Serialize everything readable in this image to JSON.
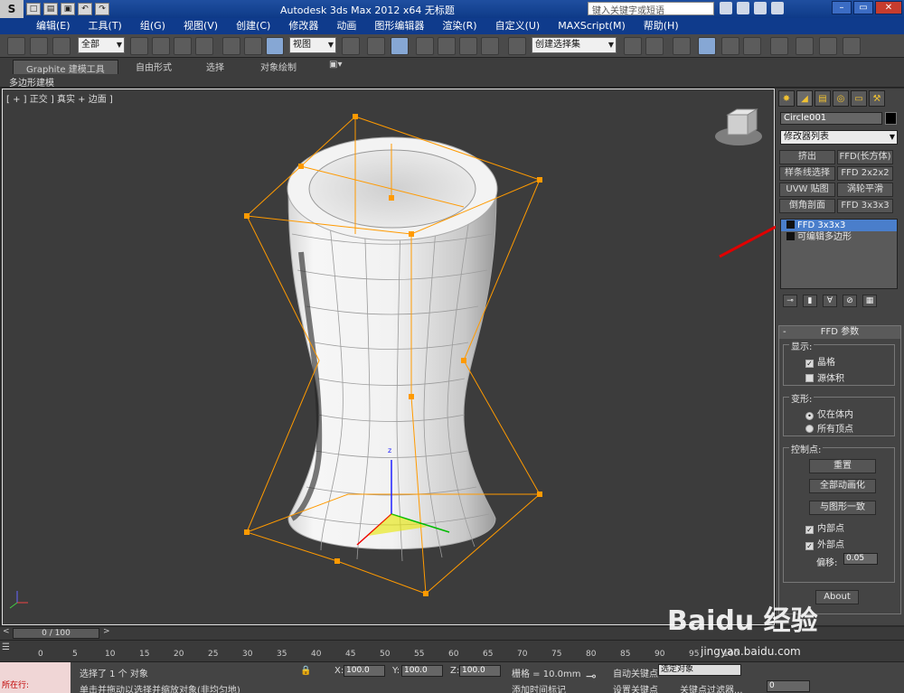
{
  "title": {
    "text": "Autodesk 3ds Max  2012 x64      无标题",
    "search_placeholder": "键入关键字或短语"
  },
  "menu": [
    "编辑(E)",
    "工具(T)",
    "组(G)",
    "视图(V)",
    "创建(C)",
    "修改器",
    "动画",
    "图形编辑器",
    "渲染(R)",
    "自定义(U)",
    "MAXScript(M)",
    "帮助(H)"
  ],
  "toolbar": {
    "select_filter": "全部",
    "ref_coord": "视图",
    "named_sel": "创建选择集"
  },
  "ribbon": {
    "tabs": [
      "Graphite 建模工具",
      "自由形式",
      "选择",
      "对象绘制"
    ],
    "subtab": "多边形建模"
  },
  "viewport": {
    "label": "[ + ] 正交 ] 真实 + 边面 ]"
  },
  "command_panel": {
    "object_name": "Circle001",
    "modifier_list": "修改器列表",
    "mod_buttons": [
      "挤出",
      "FFD(长方体)",
      "样条线选择",
      "FFD 2x2x2",
      "UVW 贴图",
      "涡轮平滑",
      "倒角剖面",
      "FFD 3x3x3"
    ],
    "stack": [
      "FFD 3x3x3",
      "可编辑多边形"
    ],
    "rollout_title": "FFD 参数",
    "display_group": "显示:",
    "lattice_label": "晶格",
    "source_volume_label": "源体积",
    "deform_group": "变形:",
    "only_in_volume": "仅在体内",
    "all_vertices": "所有顶点",
    "control_points_group": "控制点:",
    "reset_btn": "重置",
    "animate_all_btn": "全部动画化",
    "conform_btn": "与图形一致",
    "inside_points": "内部点",
    "outside_points": "外部点",
    "offset_label": "偏移:",
    "offset_value": "0.05",
    "about_btn": "About"
  },
  "timeline": {
    "slider": "0 / 100",
    "ticks": [
      "0",
      "5",
      "10",
      "15",
      "20",
      "25",
      "30",
      "35",
      "40",
      "45",
      "50",
      "55",
      "60",
      "65",
      "70",
      "75",
      "80",
      "85",
      "90",
      "95",
      "100"
    ]
  },
  "status": {
    "maxscript": "所在行:",
    "selected": "选择了 1 个 对象",
    "prompt": "单击并拖动以选择并缩放对象(非均匀地)",
    "x_label": "X:",
    "x_value": "100.0",
    "y_label": "Y:",
    "y_value": "100.0",
    "z_label": "Z:",
    "z_value": "100.0",
    "grid": "栅格 = 10.0mm",
    "add_time_tag": "添加时间标记",
    "auto_key": "自动关键点",
    "set_key": "设置关键点",
    "sel_set": "选定对象",
    "key_filters": "关键点过滤器...",
    "frame": "0"
  },
  "watermark": {
    "brand": "Baidu 经验",
    "url": "jingyan.baidu.com"
  },
  "colors": {
    "lattice": "#ff9a00",
    "selection_highlight": "#4a7ecb",
    "annotation": "#e00000"
  }
}
